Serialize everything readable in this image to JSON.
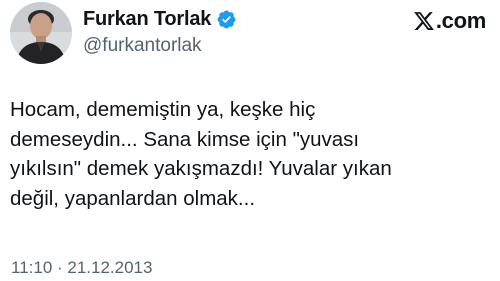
{
  "author": {
    "display_name": "Furkan Torlak",
    "handle": "@furkantorlak",
    "verified_icon": "verified-badge-icon"
  },
  "brand": {
    "logo_icon": "x-logo-icon",
    "text": ".com"
  },
  "tweet": {
    "text": "Hocam, dememiştin ya, keşke hiç\ndemeseydin... Sana kimse için \"yuvası\nyıkılsın\" demek yakışmazdı! Yuvalar yıkan\ndeğil, yapanlardan olmak..."
  },
  "meta": {
    "timestamp": "11:10 · 21.12.2013"
  },
  "colors": {
    "text_primary": "#0f1419",
    "text_secondary": "#536471",
    "verified_blue": "#1d9bf0"
  }
}
